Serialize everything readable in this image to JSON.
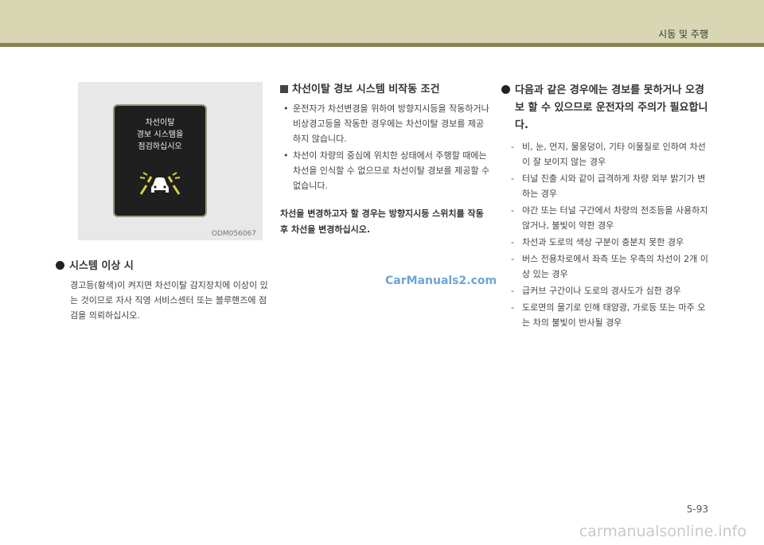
{
  "header": {
    "section_title": "시동 및 주행"
  },
  "figure": {
    "warning_lines": [
      "차선이탈",
      "경보 시스템을",
      "점검하십시오"
    ],
    "code": "ODM056067",
    "icon": "lane-departure-car-icon",
    "colors": {
      "panel": "#1f1f1f",
      "lane_marks": "#d7d23a",
      "car": "#ffffff"
    }
  },
  "system_fault": {
    "heading": "시스템 이상 시",
    "body": "경고등(황색)이 켜지면 차선이탈 감지장치에 이상이 있는 것이므로 자사 직영 서비스센터 또는 블루핸즈에 점검을 의뢰하십시오."
  },
  "non_operating": {
    "heading": "차선이탈 경보 시스템 비작동 조건",
    "bullets": [
      "운전자가 차선변경을 위하여 방향지시등을 작동하거나 비상경고등을 작동한 경우에는 차선이탈 경보를 제공하지 않습니다.",
      "차선이 차량의 중심에 위치한 상태에서 주행할 때에는 차선을 인식할 수 없으므로 차선이탈 경보를 제공할 수 없습니다."
    ],
    "note": "차선을 변경하고자 할 경우는 방향지시등 스위치를 작동 후 차선을 변경하십시오."
  },
  "caution": {
    "heading": "다음과 같은 경우에는 경보를 못하거나 오경보 할 수 있으므로 운전자의 주의가 필요합니다.",
    "items": [
      "비, 눈, 먼지, 물웅덩이, 기타 이물질로 인하여 차선이 잘 보이지 않는 경우",
      "터널 진출 시와 같이 급격하게 차량 외부 밝기가 변하는 경우",
      "야간 또는 터널 구간에서 차량의 전조등을 사용하지 않거나, 불빛이 약한 경우",
      "차선과 도로의 색상 구분이 충분치 못한 경우",
      "버스 전용차로에서 좌측 또는 우측의 차선이 2개 이상 있는 경우",
      "급커브 구간이나 도로의 경사도가 심한 경우",
      "도로면의 물기로 인해 태양광, 가로등 또는 마주 오는 차의 불빛이 반사될 경우"
    ]
  },
  "footer": {
    "page_number": "5-93",
    "watermark_mid": "CarManuals2.com",
    "watermark_bottom": "carmanualsonline.info"
  }
}
